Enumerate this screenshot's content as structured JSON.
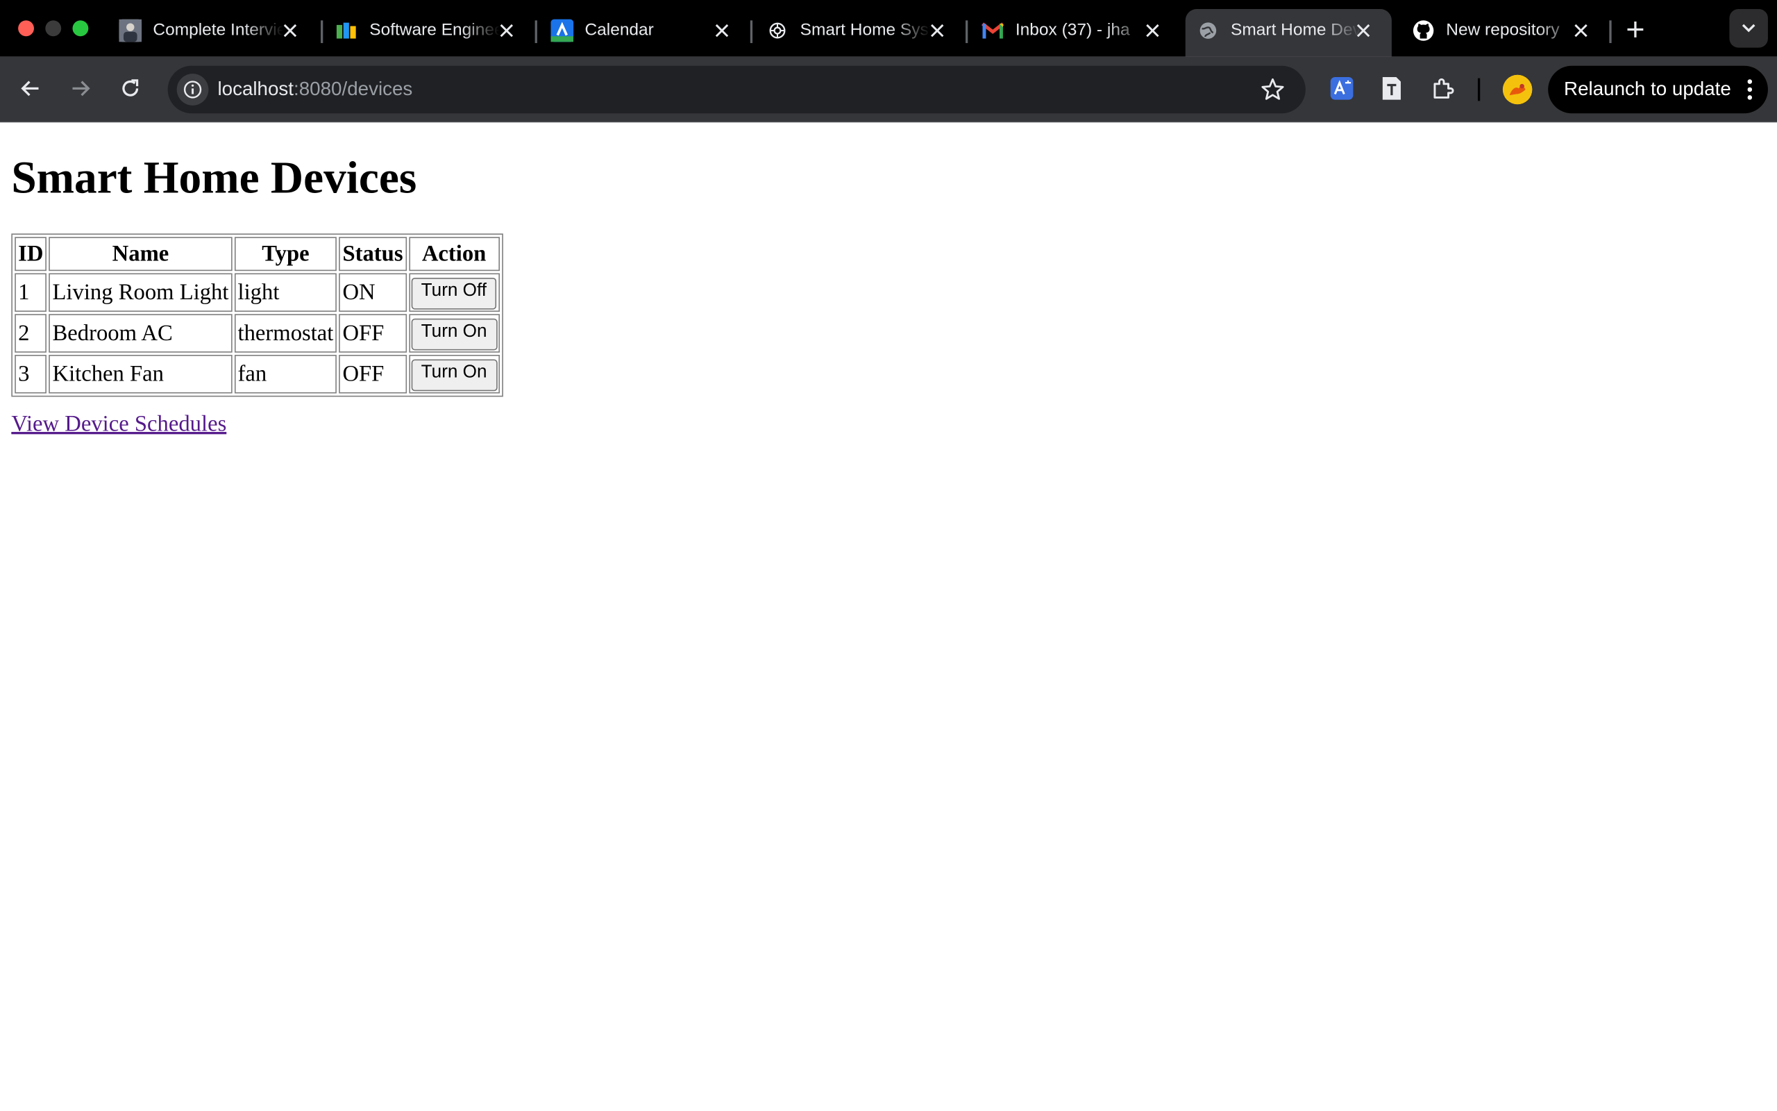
{
  "browser": {
    "tabs": [
      {
        "title": "Complete Interview",
        "favicon": "user-photo-icon",
        "active": false
      },
      {
        "title": "Software Engineering",
        "favicon": "books-icon",
        "active": false
      },
      {
        "title": "Calendar",
        "favicon": "calendar-app-icon",
        "active": false
      },
      {
        "title": "Smart Home System",
        "favicon": "openai-icon",
        "active": false
      },
      {
        "title": "Inbox (37) - jha",
        "favicon": "gmail-icon",
        "active": false
      },
      {
        "title": "Smart Home Devices",
        "favicon": "globe-icon",
        "active": true
      },
      {
        "title": "New repository",
        "favicon": "github-icon",
        "active": false
      }
    ],
    "address": {
      "host": "localhost",
      "path": ":8080/devices"
    },
    "relaunch_label": "Relaunch to update"
  },
  "page": {
    "title": "Smart Home Devices",
    "table": {
      "headers": [
        "ID",
        "Name",
        "Type",
        "Status",
        "Action"
      ],
      "rows": [
        {
          "id": "1",
          "name": "Living Room Light",
          "type": "light",
          "status": "ON",
          "action": "Turn Off"
        },
        {
          "id": "2",
          "name": "Bedroom AC",
          "type": "thermostat",
          "status": "OFF",
          "action": "Turn On"
        },
        {
          "id": "3",
          "name": "Kitchen Fan",
          "type": "fan",
          "status": "OFF",
          "action": "Turn On"
        }
      ]
    },
    "link_label": "View Device Schedules"
  },
  "colors": {
    "link_visited": "#551a8b",
    "tab_active_bg": "#353639",
    "traffic_red": "#ff5f57",
    "traffic_green": "#28c840"
  }
}
